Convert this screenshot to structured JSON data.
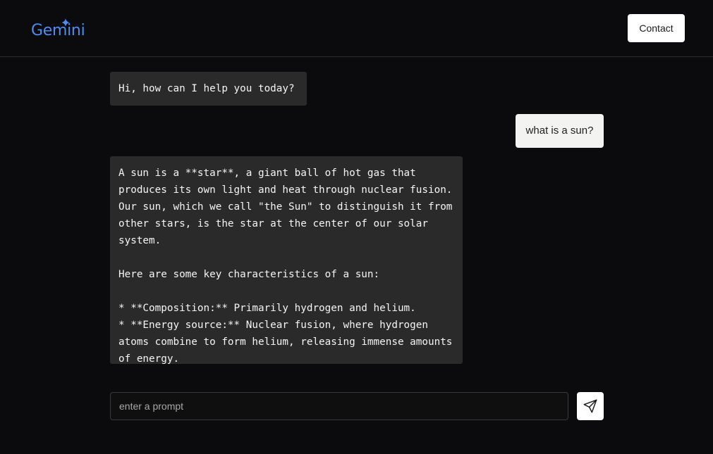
{
  "header": {
    "logo_text": "Gemini",
    "contact_label": "Contact"
  },
  "chat": {
    "messages": [
      {
        "role": "bot",
        "text": "Hi, how can I help you today?"
      },
      {
        "role": "user",
        "text": "what is a sun?"
      },
      {
        "role": "bot",
        "text": "A sun is a **star**, a giant ball of hot gas that produces its own light and heat through nuclear fusion. Our sun, which we call \"the Sun\" to distinguish it from other stars, is the star at the center of our solar system.\n\nHere are some key characteristics of a sun:\n\n* **Composition:** Primarily hydrogen and helium.\n* **Energy source:** Nuclear fusion, where hydrogen atoms combine to form helium, releasing immense amounts of energy."
      }
    ]
  },
  "prompt": {
    "placeholder": "enter a prompt",
    "value": ""
  },
  "icons": {
    "logo_spark": "sparkle-icon",
    "send": "send-icon"
  },
  "colors": {
    "background": "#0b0b0d",
    "logo": "#4b8df0",
    "bot_bubble": "#2a2a2a",
    "user_bubble": "#f3f3f1"
  }
}
